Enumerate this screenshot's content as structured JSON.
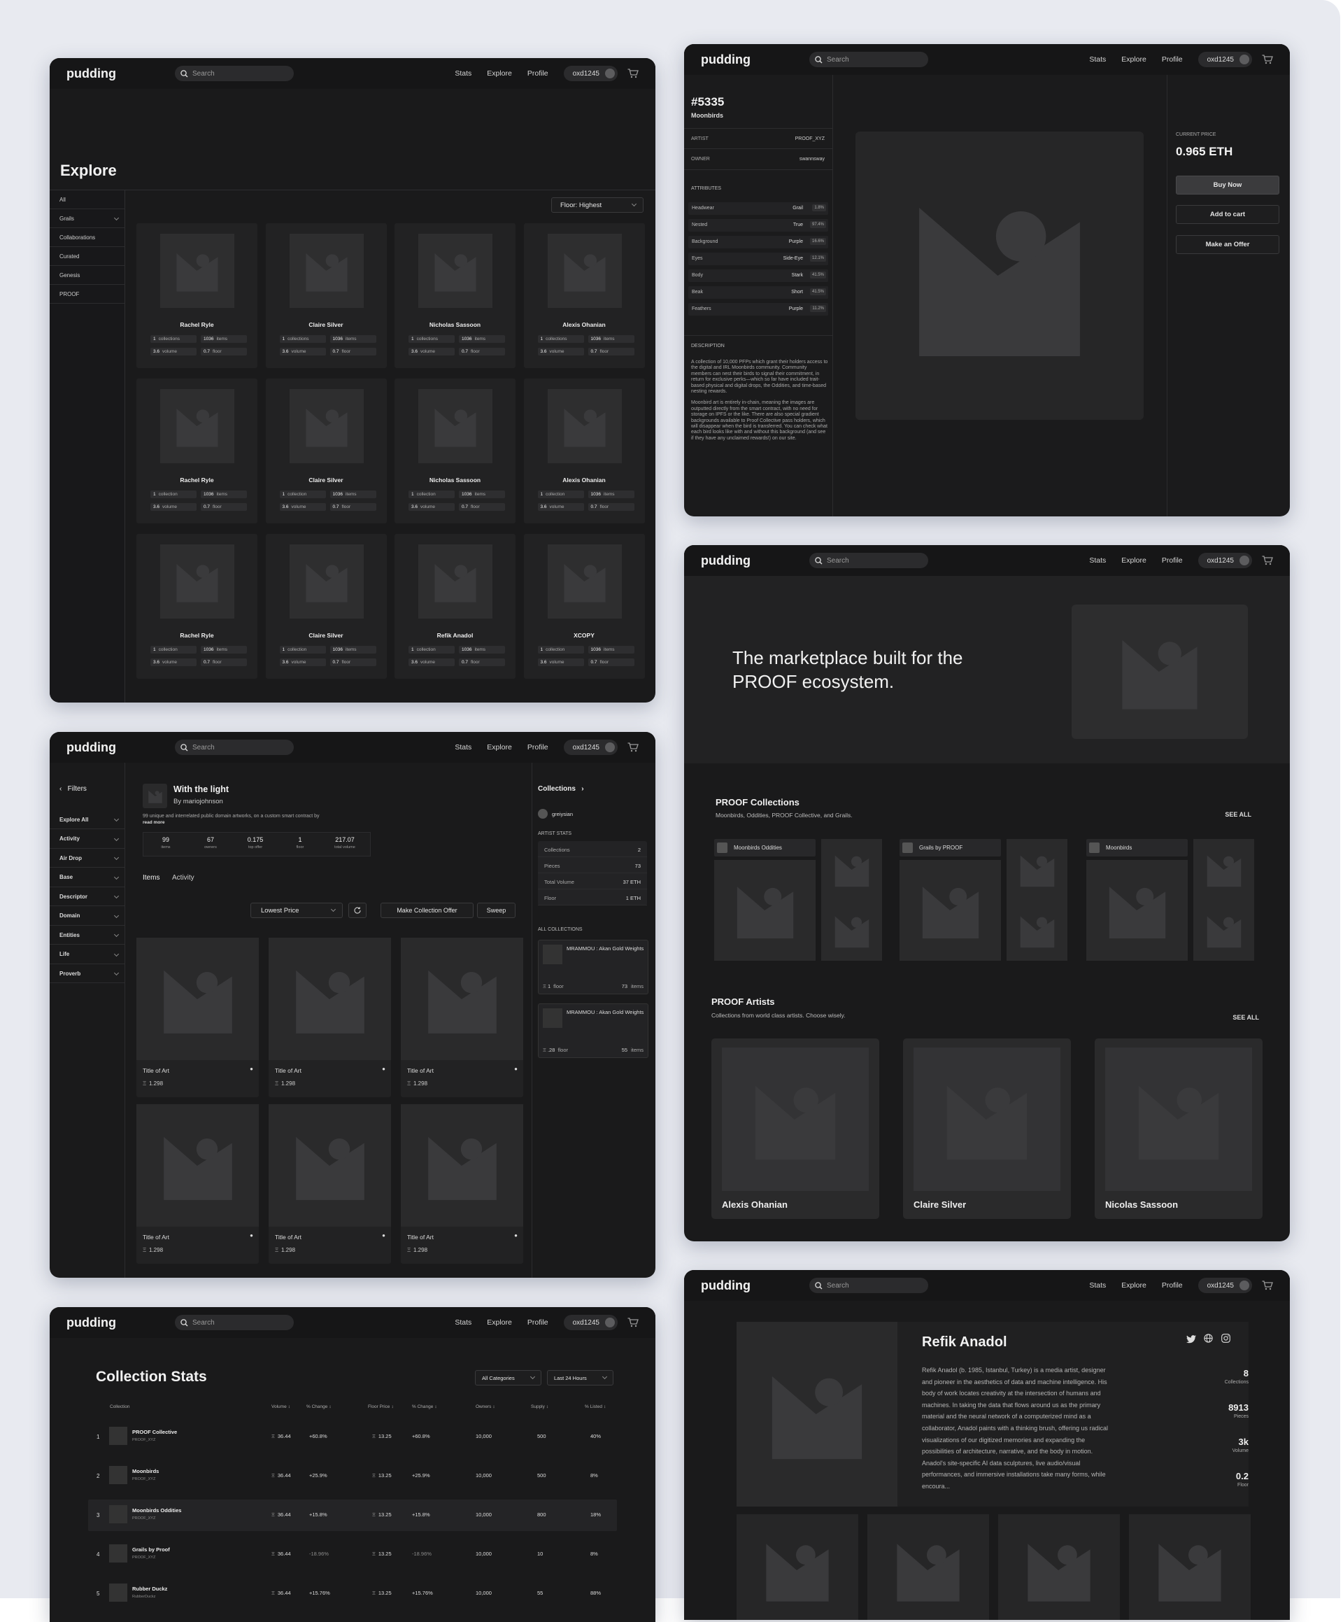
{
  "nav": {
    "logo": "pudding",
    "search_placeholder": "Search",
    "links": [
      "Stats",
      "Explore",
      "Profile"
    ],
    "wallet": "oxd1245"
  },
  "explore": {
    "title": "Explore",
    "sidebar": [
      "All",
      "Grails",
      "Collaborations",
      "Curated",
      "Genesis",
      "PROOF"
    ],
    "sort": "Floor: Highest",
    "cards": [
      {
        "name": "Rachel Ryle",
        "p1": "1",
        "l1": "collections",
        "p2": "1036",
        "l2": "items",
        "p3": "3.6",
        "l3": "volume",
        "p4": "0.7",
        "l4": "floor"
      },
      {
        "name": "Claire Silver",
        "p1": "1",
        "l1": "collections",
        "p2": "1036",
        "l2": "items",
        "p3": "3.6",
        "l3": "volume",
        "p4": "0.7",
        "l4": "floor"
      },
      {
        "name": "Nicholas Sassoon",
        "p1": "1",
        "l1": "collections",
        "p2": "1036",
        "l2": "items",
        "p3": "3.6",
        "l3": "volume",
        "p4": "0.7",
        "l4": "floor"
      },
      {
        "name": "Alexis Ohanian",
        "p1": "1",
        "l1": "collections",
        "p2": "1036",
        "l2": "items",
        "p3": "3.6",
        "l3": "volume",
        "p4": "0.7",
        "l4": "floor"
      },
      {
        "name": "Rachel Ryle",
        "p1": "1",
        "l1": "collection",
        "p2": "1036",
        "l2": "items",
        "p3": "3.6",
        "l3": "volume",
        "p4": "0.7",
        "l4": "floor"
      },
      {
        "name": "Claire Silver",
        "p1": "1",
        "l1": "collection",
        "p2": "1036",
        "l2": "items",
        "p3": "3.6",
        "l3": "volume",
        "p4": "0.7",
        "l4": "floor"
      },
      {
        "name": "Nicholas Sassoon",
        "p1": "1",
        "l1": "collection",
        "p2": "1036",
        "l2": "items",
        "p3": "3.6",
        "l3": "volume",
        "p4": "0.7",
        "l4": "floor"
      },
      {
        "name": "Alexis Ohanian",
        "p1": "1",
        "l1": "collection",
        "p2": "1036",
        "l2": "items",
        "p3": "3.6",
        "l3": "volume",
        "p4": "0.7",
        "l4": "floor"
      },
      {
        "name": "Rachel Ryle",
        "p1": "1",
        "l1": "collection",
        "p2": "1036",
        "l2": "items",
        "p3": "3.6",
        "l3": "volume",
        "p4": "0.7",
        "l4": "floor"
      },
      {
        "name": "Claire Silver",
        "p1": "1",
        "l1": "collection",
        "p2": "1036",
        "l2": "items",
        "p3": "3.6",
        "l3": "volume",
        "p4": "0.7",
        "l4": "floor"
      },
      {
        "name": "Refik Anadol",
        "p1": "1",
        "l1": "collection",
        "p2": "1036",
        "l2": "items",
        "p3": "3.6",
        "l3": "volume",
        "p4": "0.7",
        "l4": "floor"
      },
      {
        "name": "XCOPY",
        "p1": "1",
        "l1": "collection",
        "p2": "1036",
        "l2": "items",
        "p3": "3.6",
        "l3": "volume",
        "p4": "0.7",
        "l4": "floor"
      }
    ]
  },
  "item": {
    "id": "#5335",
    "collection": "Moonbirds",
    "artist_label": "ARTIST",
    "artist": "PROOF_XYZ",
    "owner_label": "OWNER",
    "owner": "swannsway",
    "attributes_label": "ATTRIBUTES",
    "attributes": [
      {
        "k": "Headwear",
        "v": "Grail",
        "p": "1.8%"
      },
      {
        "k": "Nested",
        "v": "True",
        "p": "97.4%"
      },
      {
        "k": "Background",
        "v": "Purple",
        "p": "16.6%"
      },
      {
        "k": "Eyes",
        "v": "Side-Eye",
        "p": "12.1%"
      },
      {
        "k": "Body",
        "v": "Stark",
        "p": "41.5%"
      },
      {
        "k": "Beak",
        "v": "Short",
        "p": "41.5%"
      },
      {
        "k": "Feathers",
        "v": "Purple",
        "p": "11.2%"
      }
    ],
    "description_label": "DESCRIPTION",
    "description1": "A collection of 10,000 PFPs which grant their holders access to the digital and IRL Moonbirds community. Community members can nest their birds to signal their commitment, in return for exclusive perks—which so far have included trait-based physical and digital drops, the Oddities, and time-based nesting rewards.",
    "description2": "Moonbird art is entirely in-chain, meaning the images are outputted directly from the smart contract, with no need for storage on IPFS or the like. There are also special gradient backgrounds available to Proof Collective pass holders, which will disappear when the bird is transferred. You can check what each bird looks like with and without this background (and see if they have any unclaimed rewards!) on our site.",
    "price_label": "CURRENT PRICE",
    "price": "0.965 ETH",
    "buy": "Buy Now",
    "cart": "Add to cart",
    "offer": "Make an Offer"
  },
  "collection": {
    "filters_label": "Filters",
    "filters": [
      "Explore All",
      "Activity",
      "Air Drop",
      "Base",
      "Descriptor",
      "Domain",
      "Entities",
      "Life",
      "Proverb"
    ],
    "title": "With the light",
    "by": "By mariojohnson",
    "desc": "99 unique and interrelated public domain artworks, on a custom smart contract by",
    "read_more": "read more",
    "stats": [
      {
        "v": "99",
        "l": "items"
      },
      {
        "v": "67",
        "l": "owners"
      },
      {
        "v": "0.175",
        "l": "top offer"
      },
      {
        "v": "1",
        "l": "floor"
      },
      {
        "v": "217.07",
        "l": "total volume"
      }
    ],
    "tabs": [
      "Items",
      "Activity"
    ],
    "sort": "Lowest Price",
    "make_offer": "Make Collection Offer",
    "sweep": "Sweep",
    "art_title": "Title of Art",
    "art_price": "1.298",
    "right_title": "Collections",
    "user": "greiysian",
    "artist_stats_label": "ARTIST STATS",
    "artist_stats": [
      {
        "k": "Collections",
        "v": "2"
      },
      {
        "k": "Pieces",
        "v": "73"
      },
      {
        "k": "Total Volume",
        "v": "37 ETH"
      },
      {
        "k": "Floor",
        "v": "1 ETH"
      }
    ],
    "all_collections_label": "ALL COLLECTIONS",
    "all_collections": [
      {
        "name": "MRAMMOU : Akan Gold Weights",
        "floor": "1",
        "floor_l": "floor",
        "items": "73",
        "items_l": "items"
      },
      {
        "name": "MRAMMOU : Akan Gold Weights",
        "floor": ".28",
        "floor_l": "floor",
        "items": "55",
        "items_l": "items"
      }
    ]
  },
  "stats": {
    "title": "Collection Stats",
    "filter1": "All Categories",
    "filter2": "Last 24 Hours",
    "headers": [
      "Collection",
      "Volume",
      "% Change",
      "Floor Price",
      "% Change",
      "Owners",
      "Supply",
      "% Listed"
    ],
    "rows": [
      {
        "rank": "1",
        "name": "PROOF Collective",
        "sub": "PROOF_XYZ",
        "vol": "36.44",
        "ch1": "+60.8%",
        "floor": "13.25",
        "ch2": "+60.8%",
        "owners": "10,000",
        "supply": "500",
        "listed": "40%",
        "neg": false
      },
      {
        "rank": "2",
        "name": "Moonbirds",
        "sub": "PROOF_XYZ",
        "vol": "36.44",
        "ch1": "+25.9%",
        "floor": "13.25",
        "ch2": "+25.9%",
        "owners": "10,000",
        "supply": "500",
        "listed": "8%",
        "neg": false
      },
      {
        "rank": "3",
        "name": "Moonbirds Oddities",
        "sub": "PROOF_XYZ",
        "vol": "36.44",
        "ch1": "+15.8%",
        "floor": "13.25",
        "ch2": "+15.8%",
        "owners": "10,000",
        "supply": "800",
        "listed": "18%",
        "neg": false
      },
      {
        "rank": "4",
        "name": "Grails by Proof",
        "sub": "PROOF_XYZ",
        "vol": "36.44",
        "ch1": "-18.96%",
        "floor": "13.25",
        "ch2": "-18.96%",
        "owners": "10,000",
        "supply": "10",
        "listed": "8%",
        "neg": true
      },
      {
        "rank": "5",
        "name": "Rubber Duckz",
        "sub": "RubberDuckz",
        "vol": "36.44",
        "ch1": "+15.76%",
        "floor": "13.25",
        "ch2": "+15.76%",
        "owners": "10,000",
        "supply": "55",
        "listed": "88%",
        "neg": false
      }
    ]
  },
  "home": {
    "hero": "The marketplace built for the PROOF ecosystem.",
    "collections_title": "PROOF Collections",
    "collections_sub": "Moonbirds, Oddities, PROOF Collective, and Grails.",
    "see_all": "SEE ALL",
    "collections": [
      "Moonbirds Oddities",
      "Grails by PROOF",
      "Moonbirds"
    ],
    "artists_title": "PROOF Artists",
    "artists_sub": "Collections from world class artists.  Choose wisely.",
    "see_all2": "SEE ALL",
    "artists": [
      "Alexis Ohanian",
      "Claire Silver",
      "Nicolas Sassoon"
    ]
  },
  "artist": {
    "name": "Refik Anadol",
    "bio": "Refik Anadol (b. 1985, Istanbul, Turkey) is a media artist, designer and pioneer in the aesthetics of data and machine intelligence. His body of work locates creativity at the intersection of humans and machines. In taking the data that flows around us as the primary material and the neural network of a computerized mind as a collaborator, Anadol paints with a thinking brush, offering us radical visualizations of our digitized memories and expanding the possibilities of architecture, narrative, and the body in motion. Anadol's site-specific AI data sculptures, live audio/visual performances, and immersive installations take many forms, while encoura...",
    "stats": [
      {
        "v": "8",
        "l": "Collections"
      },
      {
        "v": "8913",
        "l": "Pieces"
      },
      {
        "v": "3k",
        "l": "Volume"
      },
      {
        "v": "0.2",
        "l": "Floor"
      }
    ]
  }
}
